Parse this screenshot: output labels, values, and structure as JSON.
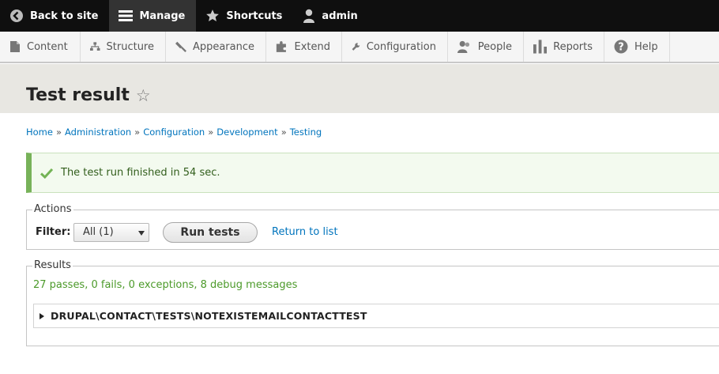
{
  "toolbar": {
    "back": "Back to site",
    "manage": "Manage",
    "shortcuts": "Shortcuts",
    "user": "admin"
  },
  "menu": {
    "items": [
      "Content",
      "Structure",
      "Appearance",
      "Extend",
      "Configuration",
      "People",
      "Reports",
      "Help"
    ]
  },
  "page": {
    "title": "Test result"
  },
  "breadcrumb": {
    "items": [
      "Home",
      "Administration",
      "Configuration",
      "Development",
      "Testing"
    ],
    "separator": "»"
  },
  "status": {
    "message": "The test run finished in 54 sec."
  },
  "actions": {
    "legend": "Actions",
    "filter_label": "Filter:",
    "filter_value": "All (1)",
    "run_button": "Run tests",
    "return_link": "Return to list"
  },
  "results": {
    "legend": "Results",
    "summary": "27 passes, 0 fails, 0 exceptions, 8 debug messages",
    "group": "DRUPAL\\CONTACT\\TESTS\\NOTEXISTEMAILCONTACTTEST"
  },
  "colors": {
    "toolbar_bg": "#0f0f0f",
    "link": "#0074bd",
    "status_accent": "#77b259",
    "summary_text": "#4c9a2a"
  }
}
